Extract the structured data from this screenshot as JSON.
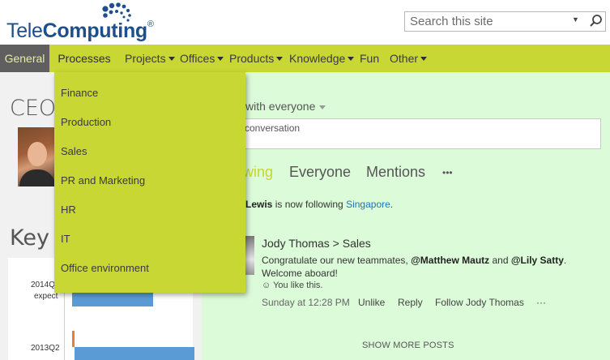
{
  "brand": {
    "name_part1": "Tele",
    "name_part2": "Computing",
    "registered": "®"
  },
  "search": {
    "placeholder": "Search this site",
    "dropdown_icon": "triangle-down-icon",
    "button_icon": "magnifier-icon"
  },
  "nav": {
    "items": [
      {
        "label": "General",
        "has_caret": false
      },
      {
        "label": "Processes",
        "has_caret": false
      },
      {
        "label": "Projects",
        "has_caret": true
      },
      {
        "label": "Offices",
        "has_caret": true
      },
      {
        "label": "Products",
        "has_caret": true
      },
      {
        "label": "Knowledge",
        "has_caret": true
      },
      {
        "label": "Fun",
        "has_caret": false
      },
      {
        "label": "Other",
        "has_caret": true
      }
    ],
    "active": "Processes",
    "colors": {
      "bar": "#c9d734",
      "general_bg": "#5f5f5f"
    }
  },
  "processes_menu": {
    "items": [
      "Finance",
      "Production",
      "Sales",
      "PR and Marketing",
      "HR",
      "IT",
      "Office environment"
    ]
  },
  "left": {
    "ceo_heading": "CEO",
    "key_heading": "Key",
    "kpi": {
      "labels": [
        "2014Q",
        "expect",
        "2013Q2"
      ]
    }
  },
  "feed": {
    "share_with": "with everyone",
    "conversation_placeholder": "conversation",
    "tabs": [
      {
        "label": "wing",
        "active": true
      },
      {
        "label": "Everyone",
        "active": false
      },
      {
        "label": "Mentions",
        "active": false
      },
      {
        "label": "•••",
        "active": false
      }
    ],
    "following": {
      "name": "Lewis",
      "text": " is now following ",
      "target": "Singapore",
      "end": "."
    },
    "post": {
      "author_line": "Jody Thomas > Sales",
      "body_pre": "Congratulate our new teammates, ",
      "mention1": "@Matthew Mautz",
      "body_mid": " and ",
      "mention2": "@Lily Satty",
      "body_end": ".",
      "line2": "Welcome aboard!",
      "like_text": "☺ You like this.",
      "time": "Sunday at 12:28 PM",
      "actions": [
        "Unlike",
        "Reply",
        "Follow Jody Thomas",
        "···"
      ]
    },
    "show_more": "SHOW MORE POSTS",
    "colors": {
      "feed_bg": "#dcfbd8",
      "accent": "#c7d630",
      "link": "#1f72b8"
    }
  }
}
